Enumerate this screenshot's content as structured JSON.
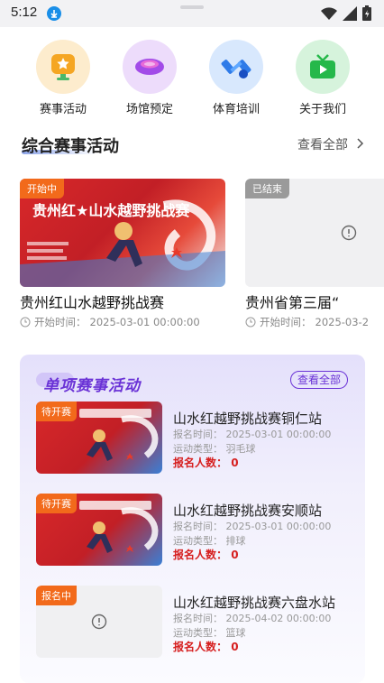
{
  "status_bar": {
    "time": "5:12"
  },
  "categories": [
    {
      "label": "赛事活动",
      "icon": "trophy-icon",
      "color": "#f5a623"
    },
    {
      "label": "场馆预定",
      "icon": "stadium-icon",
      "color": "#a24be8"
    },
    {
      "label": "体育培训",
      "icon": "dumbbell-icon",
      "color": "#2f7be8"
    },
    {
      "label": "关于我们",
      "icon": "tv-icon",
      "color": "#25b84a"
    }
  ],
  "section1": {
    "title": "综合赛事活动",
    "more": "查看全部",
    "events": [
      {
        "badge": "开始中",
        "badge_color": "#f26a1b",
        "poster_title": "贵州红★山水越野挑战赛",
        "name": "贵州红山水越野挑战赛",
        "time_label": "开始时间：",
        "time": "2025-03-01 00:00:00"
      },
      {
        "badge": "已结束",
        "badge_color": "#9a9a9a",
        "name": "贵州省第三届“",
        "time_label": "开始时间：",
        "time": "2025-03-2"
      }
    ]
  },
  "section2": {
    "title": "单项赛事活动",
    "more": "查看全部",
    "items": [
      {
        "badge": "待开赛",
        "name": "山水红越野挑战赛铜仁站",
        "time_label": "报名时间：",
        "time": "2025-03-01 00:00:00",
        "type_label": "运动类型：",
        "type": "羽毛球",
        "count_label": "报名人数：",
        "count": "0",
        "has_image": true
      },
      {
        "badge": "待开赛",
        "name": "山水红越野挑战赛安顺站",
        "time_label": "报名时间：",
        "time": "2025-03-01 00:00:00",
        "type_label": "运动类型：",
        "type": "排球",
        "count_label": "报名人数：",
        "count": "0",
        "has_image": true
      },
      {
        "badge": "报名中",
        "name": "山水红越野挑战赛六盘水站",
        "time_label": "报名时间：",
        "time": "2025-04-02 00:00:00",
        "type_label": "运动类型：",
        "type": "篮球",
        "count_label": "报名人数：",
        "count": "0",
        "has_image": false
      }
    ]
  }
}
